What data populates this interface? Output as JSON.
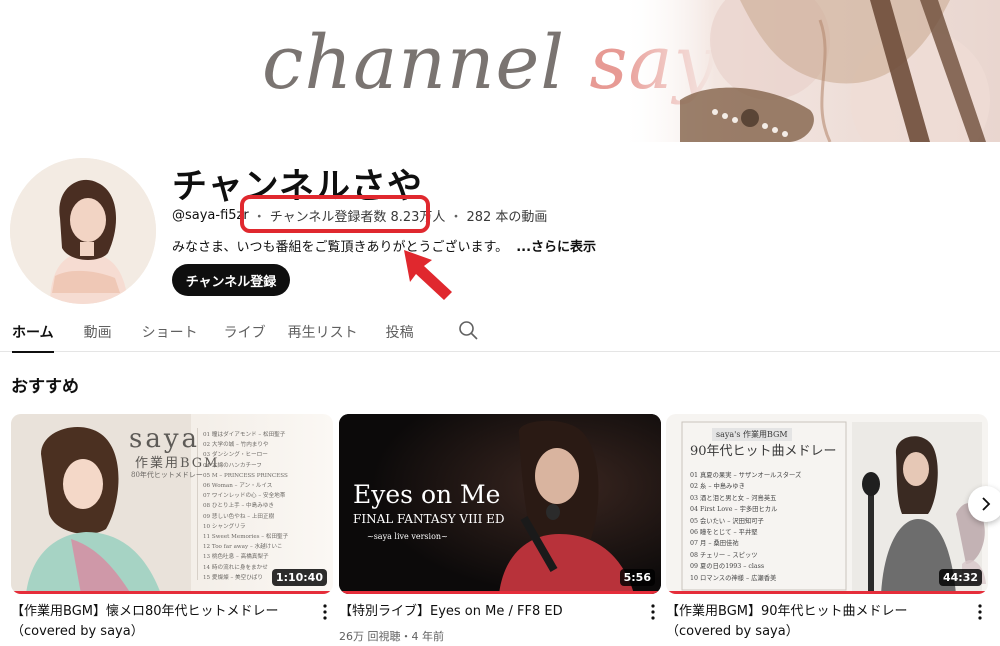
{
  "banner": {
    "word1": "channel",
    "word2": "saya"
  },
  "channel": {
    "name": "チャンネルさや",
    "handle": "@saya-fi5zr",
    "subscribers": "チャンネル登録者数 8.23万人",
    "video_count": "282 本の動画",
    "separator": "・",
    "description": "みなさま、いつも番組をご覧頂きありがとうございます。",
    "more": "...さらに表示",
    "subscribe_label": "チャンネル登録"
  },
  "tabs": [
    "ホーム",
    "動画",
    "ショート",
    "ライブ",
    "再生リスト",
    "投稿"
  ],
  "section_title": "おすすめ",
  "colors": {
    "accent_red": "#e0282e",
    "progress_red": "#e52d3a",
    "banner_pink": "#e79a94"
  },
  "videos": [
    {
      "title": "【作業用BGM】懐メロ80年代ヒットメドレー（covered by saya）",
      "duration": "1:10:40",
      "views": "",
      "thumb": {
        "saya": "saya",
        "sub": "作業用BGM",
        "sub2": "80年代ヒットメドレー",
        "tracklist": [
          "01 瞳はダイアモンド – 松田聖子",
          "02 大学の城 – 竹内まりや",
          "03 ダンシング・ヒーロー",
          "04 木綿のハンカチーフ",
          "05 M – PRINCESS PRINCESS",
          "06 Woman – アン・ルイス",
          "07 ワインレッドの心 – 安全地帯",
          "08 ひとり上手 – 中島みゆき",
          "09 悲しい色やね – 上田正樹",
          "10 シャングリラ",
          "11 Sweet Memories – 松田聖子",
          "12 Too far away – 水越けいこ",
          "13 桃色吐息 – 高橋真梨子",
          "14 時の流れに身をまかせ",
          "15 愛燦燦 – 美空ひばり"
        ]
      }
    },
    {
      "title": "【特別ライブ】Eyes on Me / FF8 ED",
      "duration": "5:56",
      "views": "26万 回視聴・4 年前",
      "thumb": {
        "title": "Eyes on Me",
        "sub": "FINAL FANTASY VIII ED",
        "sub2": "~saya live version~"
      }
    },
    {
      "title": "【作業用BGM】90年代ヒット曲メドレー（covered by saya）",
      "duration": "44:32",
      "views": "",
      "thumb": {
        "tag": "saya's 作業用BGM",
        "title": "90年代ヒット曲メドレー",
        "tracklist": [
          "01 真夏の果実 – サザンオールスターズ",
          "02 糸 – 中島みゆき",
          "03 酒と泪と男と女 – 河島英五",
          "04 First Love – 宇多田ヒカル",
          "05 会いたい – 沢田知可子",
          "06 瞳をとじて – 平井堅",
          "07 月 – 桑田佳祐",
          "08 チェリー – スピッツ",
          "09 夏の日の1993 – class",
          "10 ロマンスの神様 – 広瀬香美"
        ]
      }
    }
  ]
}
